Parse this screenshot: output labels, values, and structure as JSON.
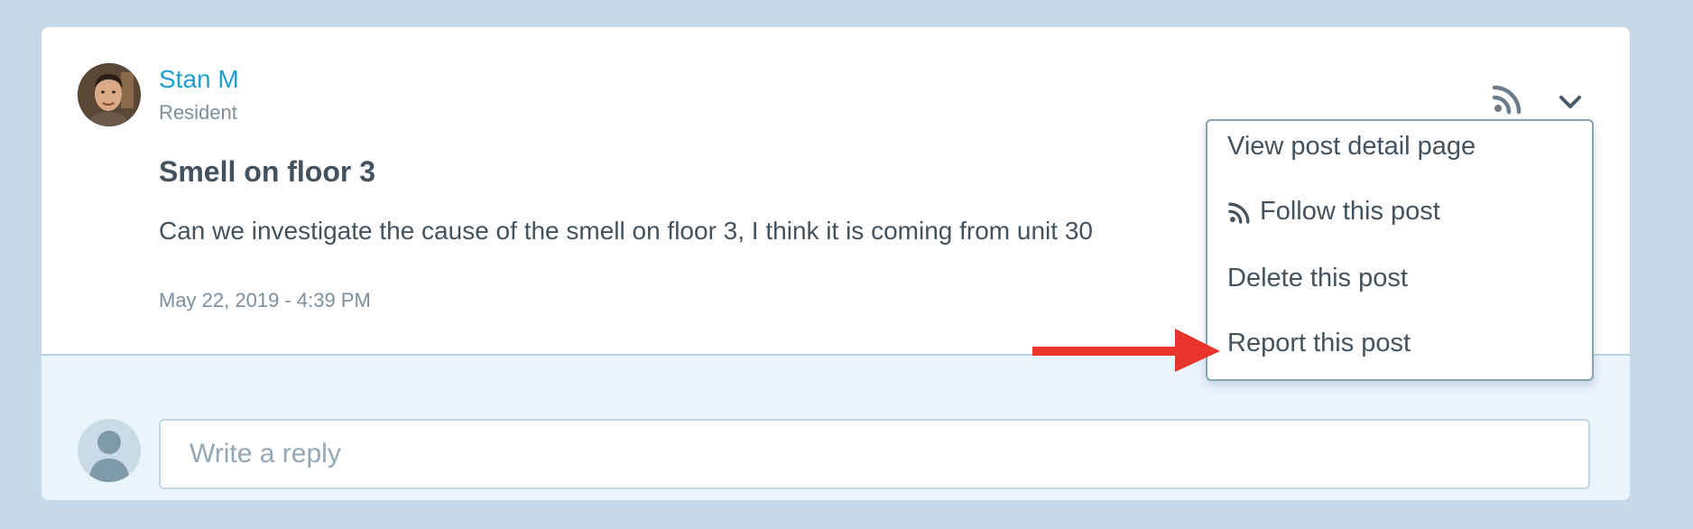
{
  "post": {
    "author": {
      "name": "Stan M",
      "role": "Resident"
    },
    "title": "Smell on floor 3",
    "body": "Can we investigate the cause of the smell on floor 3, I think it is coming from unit 30",
    "timestamp": "May 22, 2019 - 4:39 PM",
    "actions": {
      "follow_icon": "rss-icon",
      "menu_icon": "chevron-down-icon"
    }
  },
  "menu": {
    "items": [
      {
        "label": "View post detail page"
      },
      {
        "label": "Follow this post",
        "icon": "rss-icon"
      },
      {
        "label": "Delete this post"
      },
      {
        "label": "Report this post"
      }
    ]
  },
  "reply": {
    "placeholder": "Write a reply"
  },
  "annotation": {
    "arrow_color": "#e8342a"
  },
  "colors": {
    "background": "#c5d9e8",
    "accent": "#1f9fd0",
    "text": "#44525e",
    "muted": "#7d8f9c"
  }
}
